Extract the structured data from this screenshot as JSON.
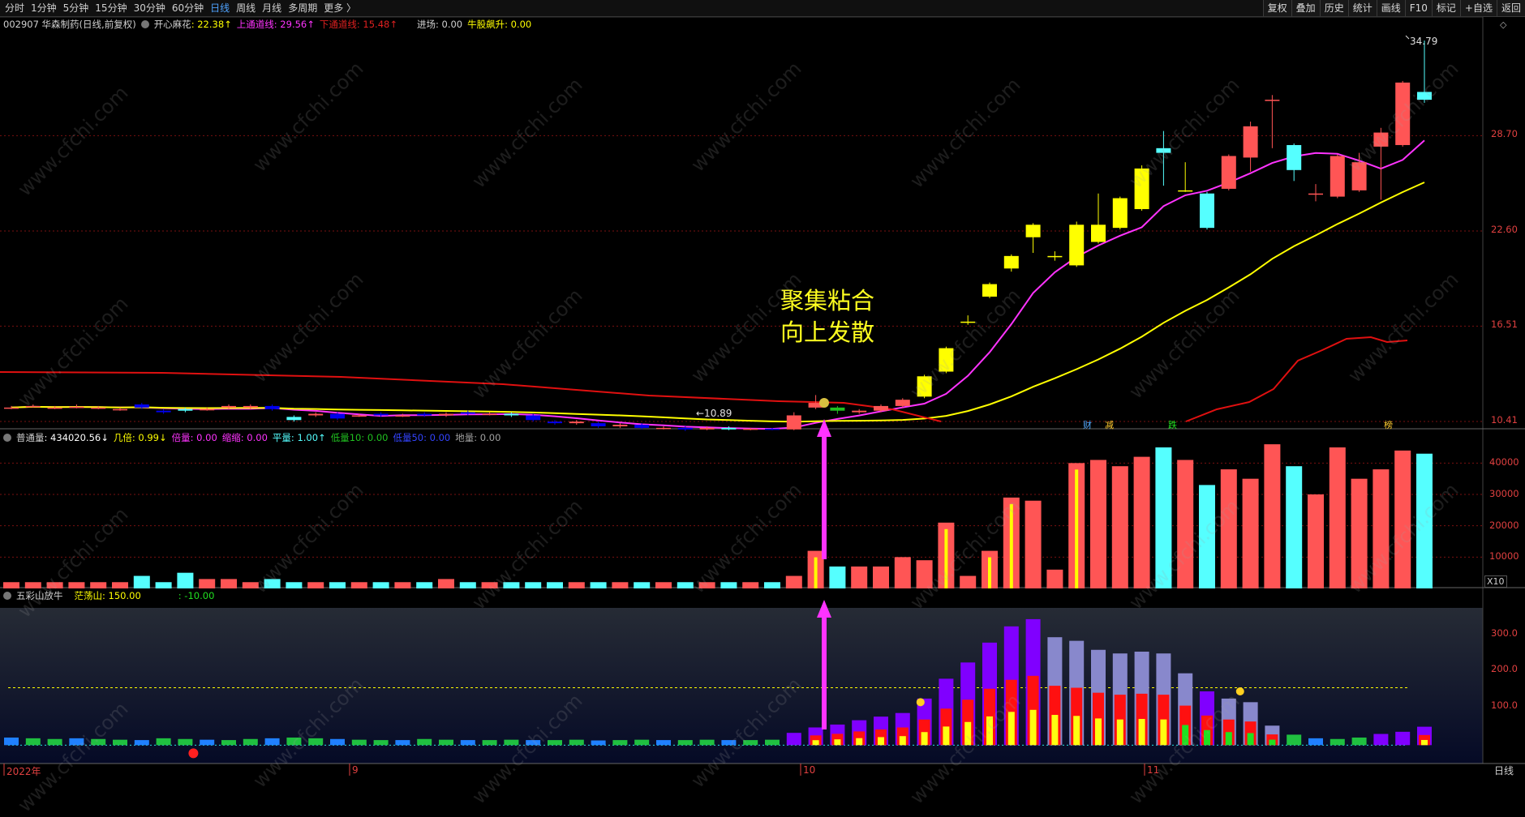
{
  "toolbar": {
    "periods": [
      "分时",
      "1分钟",
      "5分钟",
      "15分钟",
      "30分钟",
      "60分钟",
      "日线",
      "周线",
      "月线",
      "多周期",
      "更多 〉"
    ],
    "active_period": "日线",
    "right_buttons": [
      "复权",
      "叠加",
      "历史",
      "统计",
      "画线",
      "F10",
      "标记",
      "+自选",
      "返回"
    ]
  },
  "main_legend": {
    "stock": "002907 华森制药(日线,前复权)",
    "indicator_name": "开心麻花",
    "value": ": 22.38↑",
    "upper_label": "上通道线: 29.56↑",
    "lower_label": "下通道线: 15.48↑",
    "entry_label": "进场: 0.00",
    "bull_label": "牛股飙升: 0.00"
  },
  "price_axis": [
    "34.79",
    "28.70",
    "22.60",
    "16.51",
    "10.41"
  ],
  "annotations": {
    "high_price": "34.79",
    "low_price": "←10.89",
    "text_line1": "聚集粘合",
    "text_line2": "向上发散",
    "markers": [
      "财",
      "减",
      "跌",
      "榜"
    ]
  },
  "volume_legend": {
    "name": "普通量",
    "value": ": 434020.56↓",
    "ratio": "几倍: 0.99↓",
    "double": "倍量: 0.00",
    "shrink": "缩缩: 0.00",
    "flat": "平量: 1.00↑",
    "low10": "低量10: 0.00",
    "low50": "低量50: 0.00",
    "ground": "地量: 0.00"
  },
  "volume_axis": [
    "40000",
    "30000",
    "20000",
    "10000"
  ],
  "volume_unit": "X10",
  "osc_legend": {
    "name": "五彩山放牛",
    "value": "茫荡山: 150.00",
    "value2": ": -10.00"
  },
  "osc_axis": [
    "300.0",
    "200.0",
    "100.0"
  ],
  "date_axis": [
    "2022年",
    "9",
    "10",
    "11"
  ],
  "bottom_right_label": "日线",
  "watermark": "www.cfchi.com",
  "colors": {
    "up": "#ff5555",
    "down": "#55ffff",
    "yellow": "#ffff00",
    "magenta": "#ff33ff",
    "red_line": "#e01010",
    "blue_down": "#0000ee"
  },
  "chart_data": {
    "type": "candlestick",
    "candles": [
      {
        "o": 11.3,
        "c": 11.3,
        "h": 11.4,
        "l": 11.2
      },
      {
        "o": 11.4,
        "c": 11.4,
        "h": 11.5,
        "l": 11.3
      },
      {
        "o": 11.3,
        "c": 11.3,
        "h": 11.4,
        "l": 11.2
      },
      {
        "o": 11.35,
        "c": 11.35,
        "h": 11.5,
        "l": 11.25
      },
      {
        "o": 11.3,
        "c": 11.3,
        "h": 11.4,
        "l": 11.2
      },
      {
        "o": 11.2,
        "c": 11.2,
        "h": 11.3,
        "l": 11.1
      },
      {
        "o": 11.5,
        "c": 11.3,
        "h": 11.6,
        "l": 11.2
      },
      {
        "o": 11.1,
        "c": 11.0,
        "h": 11.2,
        "l": 10.9
      },
      {
        "o": 11.2,
        "c": 11.1,
        "h": 11.3,
        "l": 11.0
      },
      {
        "o": 11.2,
        "c": 11.2,
        "h": 11.3,
        "l": 11.1
      },
      {
        "o": 11.3,
        "c": 11.4,
        "h": 11.5,
        "l": 11.2
      },
      {
        "o": 11.3,
        "c": 11.4,
        "h": 11.5,
        "l": 11.2
      },
      {
        "o": 11.4,
        "c": 11.2,
        "h": 11.5,
        "l": 11.1
      },
      {
        "o": 10.7,
        "c": 10.5,
        "h": 10.8,
        "l": 10.4
      },
      {
        "o": 10.8,
        "c": 10.9,
        "h": 11.0,
        "l": 10.7
      },
      {
        "o": 10.9,
        "c": 10.6,
        "h": 11.0,
        "l": 10.5
      },
      {
        "o": 10.8,
        "c": 10.8,
        "h": 10.9,
        "l": 10.7
      },
      {
        "o": 10.9,
        "c": 10.8,
        "h": 11.0,
        "l": 10.7
      },
      {
        "o": 10.8,
        "c": 10.8,
        "h": 10.9,
        "l": 10.7
      },
      {
        "o": 10.9,
        "c": 10.8,
        "h": 11.0,
        "l": 10.7
      },
      {
        "o": 10.8,
        "c": 10.9,
        "h": 11.0,
        "l": 10.7
      },
      {
        "o": 11.0,
        "c": 10.9,
        "h": 11.1,
        "l": 10.8
      },
      {
        "o": 10.9,
        "c": 10.9,
        "h": 11.0,
        "l": 10.8
      },
      {
        "o": 10.9,
        "c": 10.8,
        "h": 11.0,
        "l": 10.7
      },
      {
        "o": 10.8,
        "c": 10.5,
        "h": 10.9,
        "l": 10.4
      },
      {
        "o": 10.4,
        "c": 10.3,
        "h": 10.5,
        "l": 10.2
      },
      {
        "o": 10.3,
        "c": 10.4,
        "h": 10.5,
        "l": 10.2
      },
      {
        "o": 10.3,
        "c": 10.1,
        "h": 10.4,
        "l": 10.0
      },
      {
        "o": 10.1,
        "c": 10.2,
        "h": 10.3,
        "l": 10.0
      },
      {
        "o": 10.2,
        "c": 10.0,
        "h": 10.3,
        "l": 9.9
      },
      {
        "o": 10.0,
        "c": 10.0,
        "h": 10.1,
        "l": 9.9
      },
      {
        "o": 10.0,
        "c": 9.9,
        "h": 10.1,
        "l": 9.8
      },
      {
        "o": 9.9,
        "c": 10.0,
        "h": 10.1,
        "l": 9.85
      },
      {
        "o": 10.0,
        "c": 9.9,
        "h": 10.1,
        "l": 9.85
      },
      {
        "o": 9.9,
        "c": 9.95,
        "h": 10.0,
        "l": 9.85
      },
      {
        "o": 9.95,
        "c": 9.9,
        "h": 10.0,
        "l": 9.85
      },
      {
        "o": 9.9,
        "c": 10.8,
        "h": 11.0,
        "l": 9.85
      },
      {
        "o": 11.3,
        "c": 11.6,
        "h": 12.1,
        "l": 11.2
      },
      {
        "o": 11.3,
        "c": 11.1,
        "h": 11.4,
        "l": 10.9
      },
      {
        "o": 11.0,
        "c": 11.1,
        "h": 11.2,
        "l": 10.9
      },
      {
        "o": 11.1,
        "c": 11.4,
        "h": 11.5,
        "l": 11.0
      },
      {
        "o": 11.4,
        "c": 11.8,
        "h": 11.9,
        "l": 11.3
      },
      {
        "o": 12.0,
        "c": 13.3,
        "h": 13.4,
        "l": 11.9
      },
      {
        "o": 13.6,
        "c": 15.1,
        "h": 15.2,
        "l": 13.5
      },
      {
        "o": 16.8,
        "c": 16.8,
        "h": 17.2,
        "l": 16.6
      },
      {
        "o": 18.4,
        "c": 19.2,
        "h": 19.3,
        "l": 18.3
      },
      {
        "o": 20.2,
        "c": 21.0,
        "h": 21.1,
        "l": 20.0
      },
      {
        "o": 22.2,
        "c": 23.0,
        "h": 23.1,
        "l": 21.2
      },
      {
        "o": 21.0,
        "c": 21.0,
        "h": 21.3,
        "l": 20.7
      },
      {
        "o": 20.4,
        "c": 23.0,
        "h": 23.2,
        "l": 20.3
      },
      {
        "o": 21.9,
        "c": 23.0,
        "h": 25.0,
        "l": 21.8
      },
      {
        "o": 22.8,
        "c": 24.7,
        "h": 24.8,
        "l": 22.7
      },
      {
        "o": 24.0,
        "c": 26.6,
        "h": 26.8,
        "l": 23.9
      },
      {
        "o": 27.9,
        "c": 27.6,
        "h": 29.0,
        "l": 25.5
      },
      {
        "o": 25.2,
        "c": 25.2,
        "h": 27.0,
        "l": 25.1
      },
      {
        "o": 25.0,
        "c": 22.8,
        "h": 25.1,
        "l": 22.7
      },
      {
        "o": 25.3,
        "c": 27.4,
        "h": 27.5,
        "l": 25.2
      },
      {
        "o": 27.3,
        "c": 29.3,
        "h": 29.6,
        "l": 26.4
      },
      {
        "o": 31.0,
        "c": 31.0,
        "h": 31.3,
        "l": 27.9
      },
      {
        "o": 28.1,
        "c": 26.5,
        "h": 28.2,
        "l": 25.8
      },
      {
        "o": 25.0,
        "c": 25.0,
        "h": 25.6,
        "l": 24.5
      },
      {
        "o": 24.8,
        "c": 27.4,
        "h": 27.5,
        "l": 24.7
      },
      {
        "o": 25.2,
        "c": 27.0,
        "h": 27.6,
        "l": 25.1
      },
      {
        "o": 28.0,
        "c": 28.9,
        "h": 29.2,
        "l": 24.6
      },
      {
        "o": 28.1,
        "c": 32.1,
        "h": 32.2,
        "l": 28.0
      },
      {
        "o": 31.5,
        "c": 31.0,
        "h": 34.79,
        "l": 30.8
      }
    ],
    "volume_ratio": [
      0.02,
      0.02,
      0.02,
      0.02,
      0.02,
      0.02,
      0.04,
      0.02,
      0.05,
      0.03,
      0.03,
      0.02,
      0.03,
      0.02,
      0.02,
      0.02,
      0.02,
      0.02,
      0.02,
      0.02,
      0.03,
      0.02,
      0.02,
      0.02,
      0.02,
      0.02,
      0.02,
      0.02,
      0.02,
      0.02,
      0.02,
      0.02,
      0.02,
      0.02,
      0.02,
      0.02,
      0.04,
      0.12,
      0.07,
      0.07,
      0.07,
      0.1,
      0.09,
      0.21,
      0.04,
      0.12,
      0.29,
      0.28,
      0.06,
      0.4,
      0.41,
      0.39,
      0.42,
      0.45,
      0.41,
      0.33,
      0.38,
      0.35,
      0.46,
      0.39,
      0.3,
      0.45,
      0.35,
      0.38,
      0.44,
      0.43
    ],
    "osc_values": [
      12,
      10,
      8,
      10,
      8,
      6,
      5,
      10,
      8,
      6,
      5,
      8,
      10,
      12,
      10,
      8,
      6,
      5,
      5,
      8,
      6,
      5,
      5,
      6,
      5,
      5,
      6,
      4,
      5,
      6,
      5,
      5,
      6,
      5,
      5,
      6,
      25,
      40,
      48,
      60,
      70,
      80,
      120,
      175,
      220,
      275,
      320,
      340,
      290,
      280,
      255,
      245,
      250,
      245,
      190,
      140,
      120,
      110,
      45,
      20,
      10,
      8,
      12,
      22,
      28,
      42
    ],
    "osc_level": 150,
    "osc_ylim": [
      -15,
      360
    ],
    "vol_ylim": [
      0,
      45000
    ]
  }
}
